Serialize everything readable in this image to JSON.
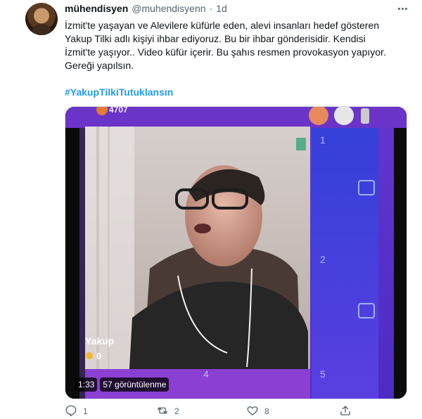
{
  "tweet": {
    "display_name": "mühendisyen",
    "handle": "@muhendisyenn",
    "separator": "·",
    "time": "1d",
    "text_lines": [
      "İzmit'te yaşayan ve Alevilere küfürle eden, alevi insanları hedef gösteren",
      "Yakup Tilki adlı kişiyi ihbar ediyoruz. Bu bir ihbar gönderisidir. Kendisi",
      "İzmit'te yaşıyor.. Video küfür içerir. Bu şahıs resmen provokasyon yapıyor.",
      "Gereği yapılsın."
    ],
    "hashtag": "#YakupTilkiTutuklansın"
  },
  "video": {
    "name_overlay": "Yakup",
    "coins_overlay": "0",
    "score_overlay": "4707",
    "duration": "1:33",
    "views": "57 görüntülenme"
  },
  "actions": {
    "reply_count": "1",
    "retweet_count": "2",
    "like_count": "8"
  },
  "icons": [
    "more-icon",
    "reply-icon",
    "retweet-icon",
    "like-icon",
    "share-icon"
  ]
}
